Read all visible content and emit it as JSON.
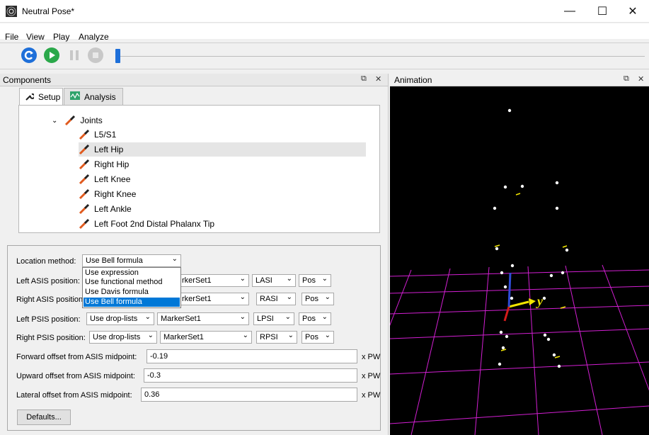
{
  "window": {
    "title": "Neutral Pose*",
    "controls": {
      "minimize": "—",
      "maximize": "☐",
      "close": "✕"
    }
  },
  "menu": [
    "File",
    "View",
    "Play",
    "Analyze"
  ],
  "toolbar": {
    "buttons": [
      {
        "name": "refresh-icon",
        "color": "#1e6fd9"
      },
      {
        "name": "play-icon",
        "color": "#2aa84a"
      },
      {
        "name": "pause-icon",
        "color": "#c8c8c8"
      },
      {
        "name": "stop-icon",
        "color": "#c8c8c8"
      }
    ],
    "slider_fraction": 0.0
  },
  "components": {
    "title": "Components",
    "ctrl_float": "⧉",
    "ctrl_close": "✕",
    "tabs": [
      {
        "label": "Setup",
        "icon": "wrench-icon",
        "active": true
      },
      {
        "label": "Analysis",
        "icon": "graph-icon",
        "active": false
      }
    ],
    "tree": {
      "parent": {
        "label": "Joints",
        "expanded": true
      },
      "items": [
        {
          "label": "L5/S1",
          "selected": false
        },
        {
          "label": "Left Hip",
          "selected": true
        },
        {
          "label": "Right Hip",
          "selected": false
        },
        {
          "label": "Left Knee",
          "selected": false
        },
        {
          "label": "Right Knee",
          "selected": false
        },
        {
          "label": "Left Ankle",
          "selected": false
        },
        {
          "label": "Left Foot 2nd Distal Phalanx Tip",
          "selected": false
        }
      ]
    }
  },
  "properties": {
    "location_method": {
      "label": "Location method:",
      "value": "Use Bell formula",
      "options": [
        "Use expression",
        "Use functional method",
        "Use Davis formula",
        "Use Bell formula"
      ]
    },
    "positions": [
      {
        "label": "Left ASIS position:",
        "source": "",
        "marker_set": "rkerSet1",
        "marker": "LASI",
        "attr": "Pos"
      },
      {
        "label": "Right ASIS position",
        "source": "",
        "marker_set": "rkerSet1",
        "marker": "RASI",
        "attr": "Pos"
      },
      {
        "label": "Left PSIS position:",
        "source": "Use drop-lists",
        "marker_set": "MarkerSet1",
        "marker": "LPSI",
        "attr": "Pos"
      },
      {
        "label": "Right PSIS position:",
        "source": "Use drop-lists",
        "marker_set": "MarkerSet1",
        "marker": "RPSI",
        "attr": "Pos"
      }
    ],
    "offsets": [
      {
        "label": "Forward offset from ASIS midpoint:",
        "value": "-0.19",
        "unit": "x PW"
      },
      {
        "label": "Upward offset from ASIS midpoint:",
        "value": "-0.3",
        "unit": "x PW"
      },
      {
        "label": "Lateral offset from ASIS midpoint:",
        "value": "0.36",
        "unit": "x PW"
      }
    ],
    "defaults_label": "Defaults..."
  },
  "animation": {
    "title": "Animation",
    "ctrl_float": "⧉",
    "ctrl_close": "✕",
    "axis_label": "y",
    "colors": {
      "grid": "#d21fd2",
      "marker": "#ffffff",
      "axis_y": "#f2e600",
      "axis_z": "#2f4bd6",
      "axis_x": "#d41b1b"
    }
  }
}
